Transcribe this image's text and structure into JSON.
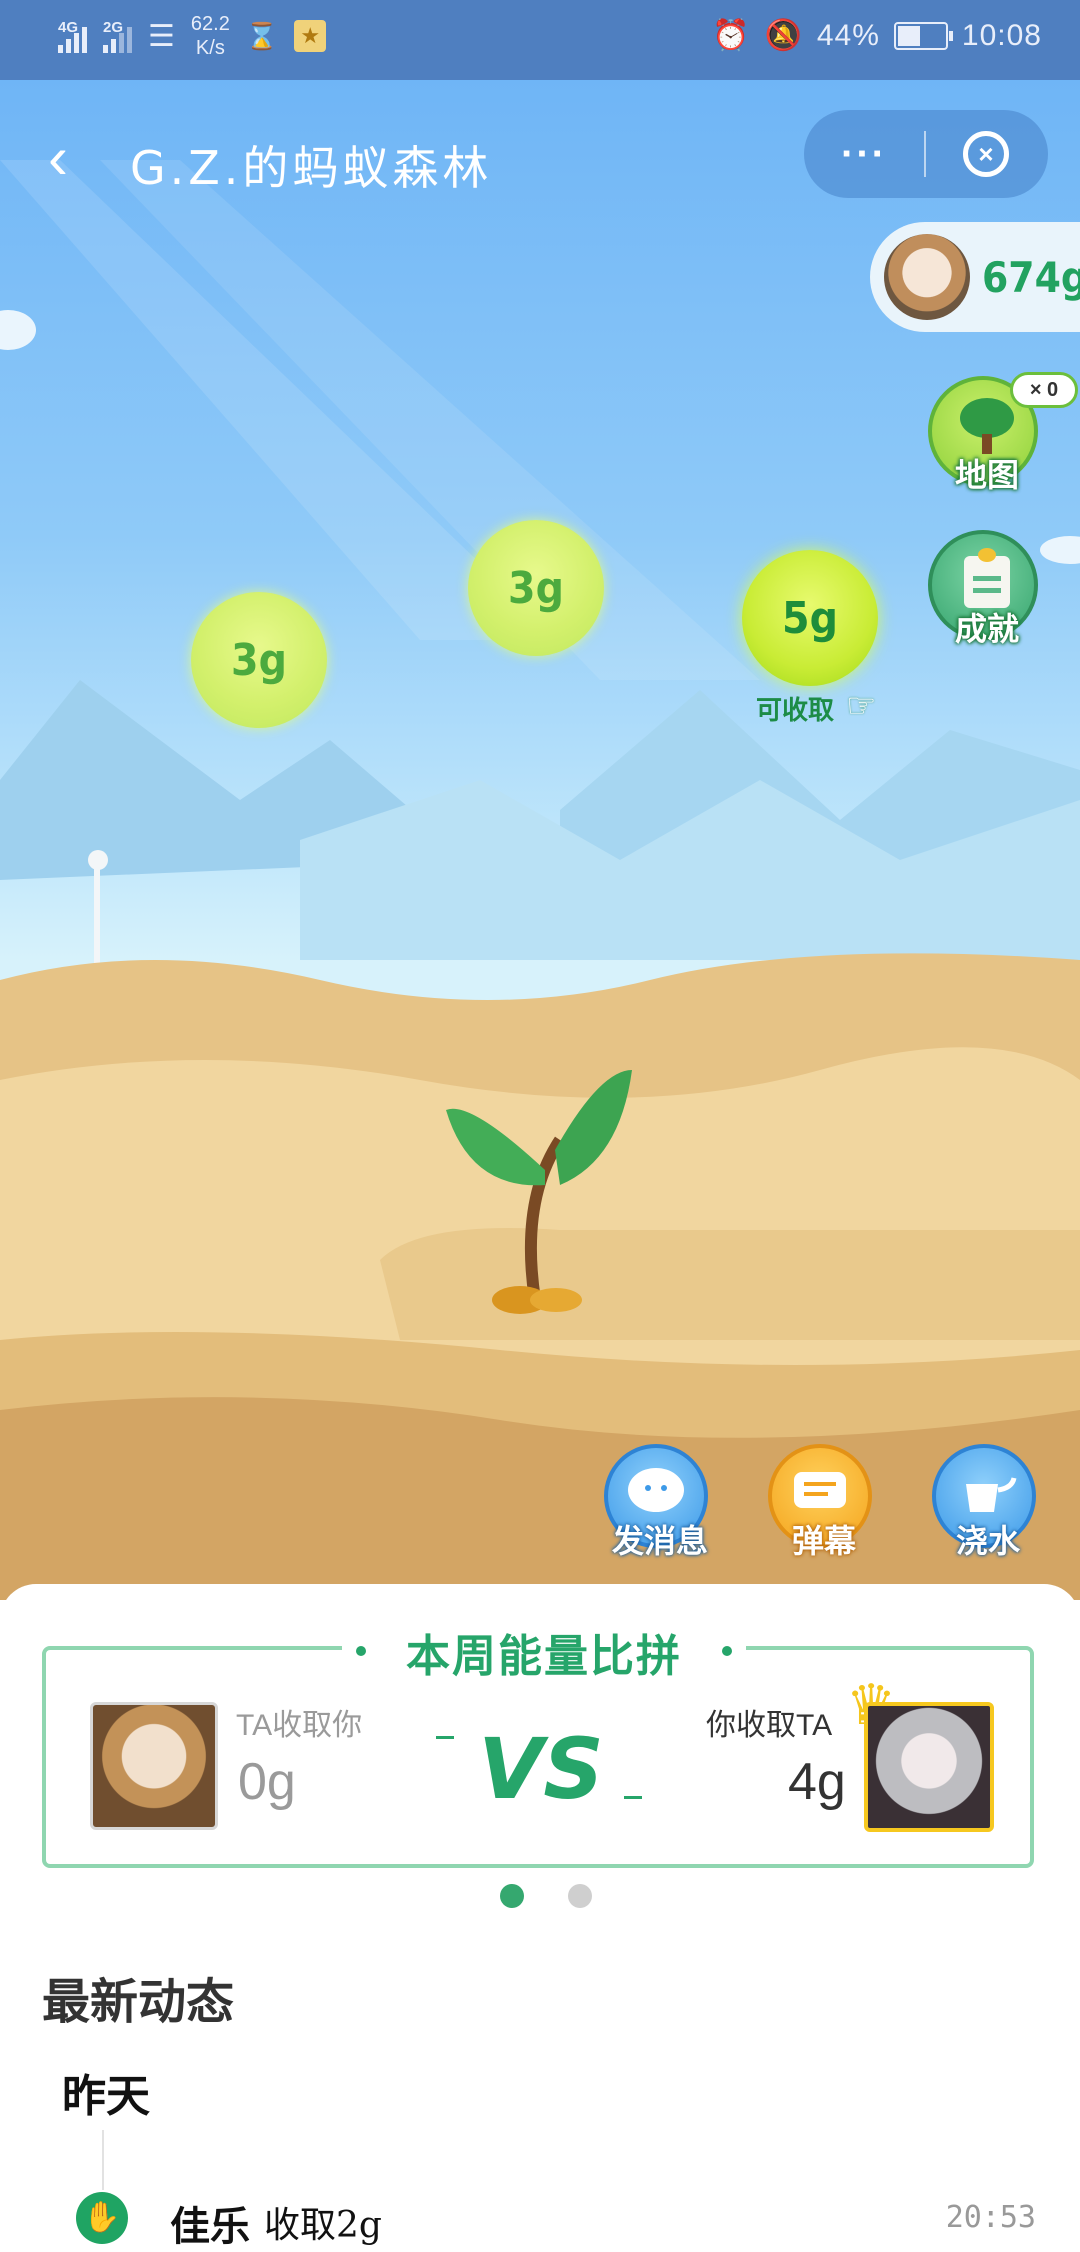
{
  "status_bar": {
    "net1": "4G",
    "net2": "2G",
    "speed_value": "62.2",
    "speed_unit": "K/s",
    "battery": "44%",
    "time": "10:08"
  },
  "header": {
    "title": "G.Z.的蚂蚁森林",
    "more_label": "···"
  },
  "energy_total": "674g",
  "side_buttons": {
    "map_label": "地图",
    "map_badge": "× 0",
    "achievement_label": "成就"
  },
  "energy_balls": [
    {
      "value": "3g"
    },
    {
      "value": "3g"
    },
    {
      "value": "5g"
    }
  ],
  "collect_label": "可收取",
  "actions": {
    "message": "发消息",
    "danmu": "弹幕",
    "water": "浇水"
  },
  "weekly": {
    "title": "本周能量比拼",
    "left_label": "TA收取你",
    "left_value": "0g",
    "vs": "VS",
    "right_label": "你收取TA",
    "right_value": "4g"
  },
  "pager": {
    "count": 2,
    "active": 0
  },
  "news": {
    "title": "最新动态",
    "day": "昨天",
    "items": [
      {
        "name": "佳乐",
        "action": "收取2g",
        "time": "20:53"
      }
    ]
  },
  "colors": {
    "status_bar": "#4f7fc0",
    "accent_green": "#26a56a",
    "energy_text": "#22a260"
  }
}
